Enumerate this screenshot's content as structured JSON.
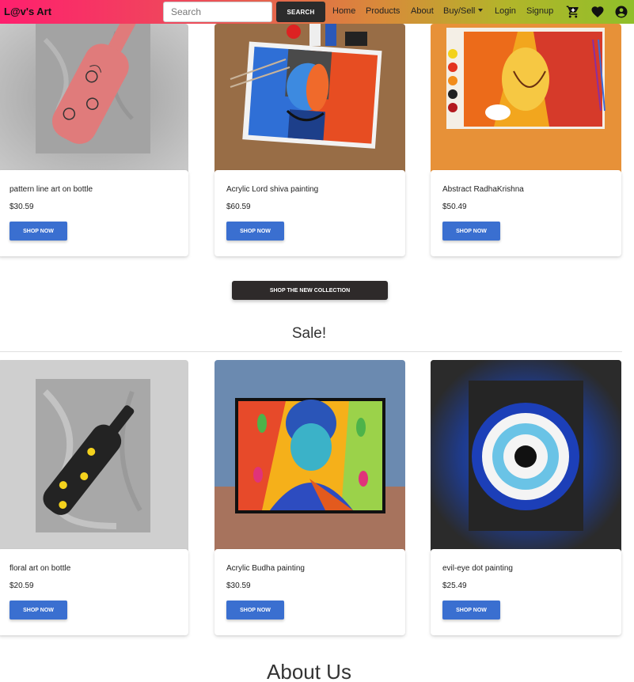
{
  "navbar": {
    "brand": "L@v's Art",
    "search_placeholder": "Search",
    "search_button": "SEARCH",
    "links": [
      "Home",
      "Products",
      "About",
      "Buy/Sell",
      "Login",
      "Signup"
    ],
    "icons": [
      "cart-icon",
      "heart-icon",
      "user-account-icon"
    ]
  },
  "featured": [
    {
      "title": "pattern line art on bottle",
      "price": "$30.59",
      "button": "SHOP NOW"
    },
    {
      "title": "Acrylic Lord shiva painting",
      "price": "$60.59",
      "button": "SHOP NOW"
    },
    {
      "title": "Abstract RadhaKrishna",
      "price": "$50.49",
      "button": "SHOP NOW"
    }
  ],
  "collection_button": "SHOP THE NEW COLLECTION",
  "sale": {
    "heading": "Sale!",
    "items": [
      {
        "title": "floral art on bottle",
        "price": "$20.59",
        "button": "SHOP NOW"
      },
      {
        "title": "Acrylic Budha painting",
        "price": "$30.59",
        "button": "SHOP NOW"
      },
      {
        "title": "evil-eye dot painting",
        "price": "$25.49",
        "button": "SHOP NOW"
      }
    ]
  },
  "about_heading": "About Us",
  "colors": {
    "button": "#3a6fd0",
    "dark_button": "#2e2a2a",
    "nav_start": "#ff1f6e",
    "nav_end": "#8fbf2a"
  }
}
